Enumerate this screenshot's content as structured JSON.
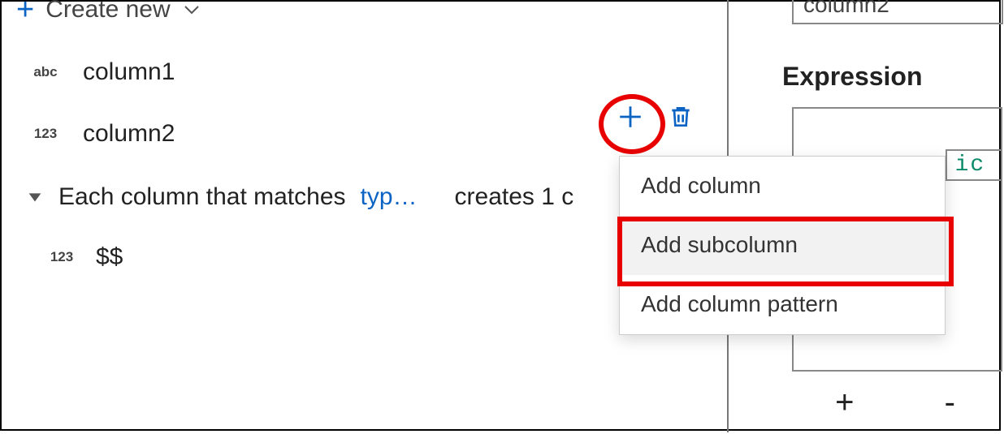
{
  "left": {
    "create_label": "Create new",
    "columns": [
      {
        "type_label": "abc",
        "name": "column1"
      },
      {
        "type_label": "123",
        "name": "column2"
      }
    ],
    "match_row": {
      "prefix": "Each column that matches",
      "link": "typ…",
      "suffix": "creates 1 c"
    },
    "subcolumn": {
      "type_label": "123",
      "name": "$$"
    }
  },
  "menu": {
    "items": [
      "Add column",
      "Add subcolumn",
      "Add column pattern"
    ],
    "highlight_index": 1
  },
  "right": {
    "input_value": "column2",
    "expression_label": "Expression",
    "expression_fragment": "ic ",
    "plus": "+",
    "minus": "-"
  }
}
